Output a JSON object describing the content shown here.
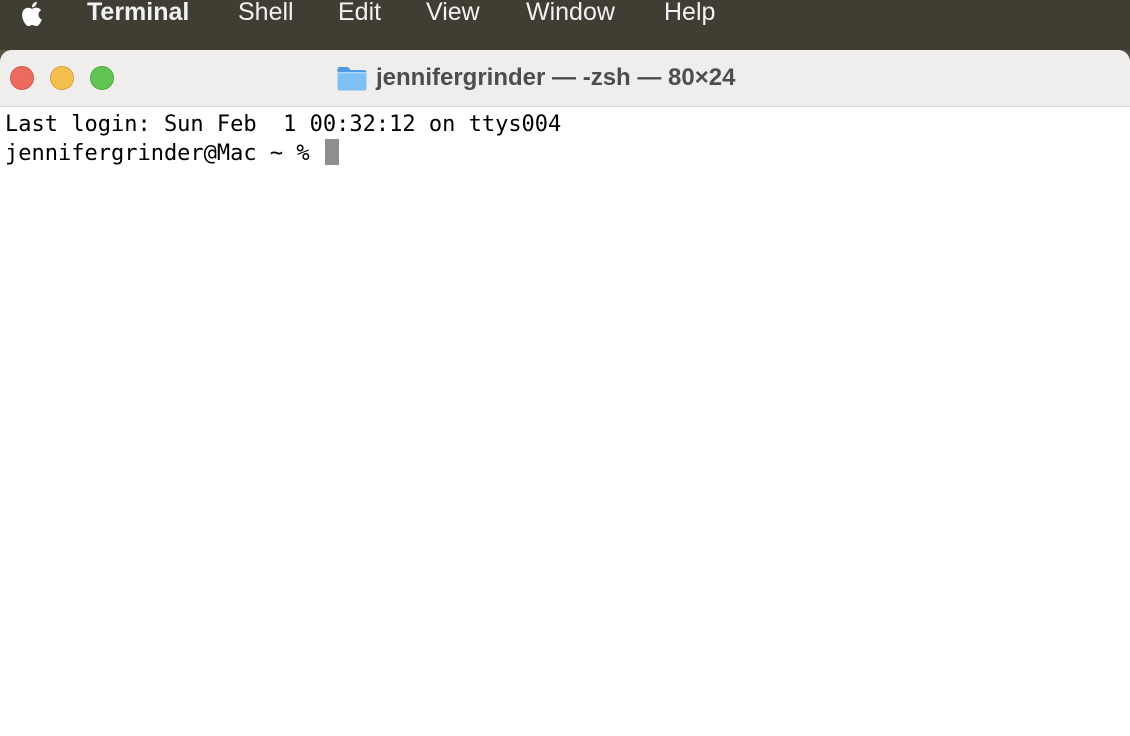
{
  "menubar": {
    "apple_icon": "apple-logo-icon",
    "app_name": "Terminal",
    "items": [
      "Shell",
      "Edit",
      "View",
      "Window",
      "Help"
    ]
  },
  "window": {
    "title": "jennifergrinder — -zsh — 80×24",
    "title_icon": "folder-icon",
    "buttons": {
      "close": "close-button",
      "minimize": "minimize-button",
      "zoom": "zoom-button"
    }
  },
  "terminal": {
    "lines": [
      "Last login: Sun Feb  1 00:32:12 on ttys004",
      "jennifergrinder@Mac ~ % "
    ]
  },
  "colors": {
    "close": "#ed6a5e",
    "minimize": "#f5bf4f",
    "zoom": "#61c554",
    "folder": "#6fb4ee",
    "cursor": "#8e8e8e"
  }
}
